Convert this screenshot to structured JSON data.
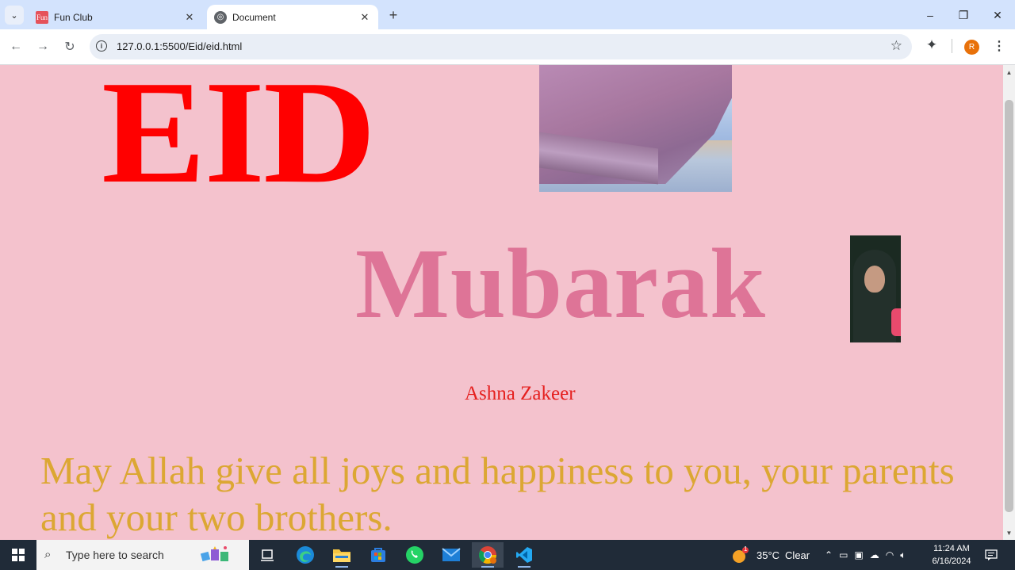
{
  "browser": {
    "tabs": [
      {
        "title": "Fun Club",
        "favicon_text": "Fun",
        "active": false
      },
      {
        "title": "Document",
        "active": true
      }
    ],
    "url": "127.0.0.1:5500/Eid/eid.html",
    "profile_initial": "R"
  },
  "page": {
    "heading1": "EID",
    "heading2": "Mubarak",
    "name": "Ashna Zakeer",
    "message": "May Allah give all joys and happiness to you, your parents and your two brothers.",
    "colors": {
      "background": "#f4c2cd",
      "eid": "#ff0000",
      "mubarak": "#de7497",
      "name": "#e5201f",
      "message": "#dca733"
    }
  },
  "taskbar": {
    "search_placeholder": "Type here to search",
    "weather_temp": "35°C",
    "weather_desc": "Clear",
    "weather_badge": "1",
    "time": "11:24 AM",
    "date": "6/16/2024",
    "apps": [
      "task-view",
      "edge",
      "file-explorer",
      "microsoft-store",
      "whatsapp",
      "mail",
      "chrome",
      "vscode"
    ]
  }
}
